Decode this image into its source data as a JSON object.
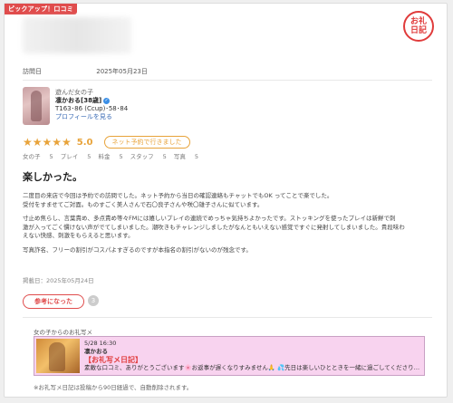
{
  "badge": "ピックアップ！口コミ",
  "stamp": {
    "line1": "お礼",
    "line2": "日記"
  },
  "visit": {
    "label": "訪問日",
    "date": "2025年05月23日"
  },
  "girl": {
    "label": "遊んだ女の子",
    "name": "凛かおる[38歳]",
    "specs": "T163･86 (Ccup)･58･84",
    "profile_link": "プロフィールを見る"
  },
  "rating": {
    "stars": "★★★★★",
    "score": "5.0",
    "net_booking": "ネット予約で行きました",
    "sub": [
      {
        "label": "女の子",
        "value": "5"
      },
      {
        "label": "プレイ",
        "value": "5"
      },
      {
        "label": "料金",
        "value": "5"
      },
      {
        "label": "スタッフ",
        "value": "5"
      },
      {
        "label": "写真",
        "value": "5"
      }
    ]
  },
  "review": {
    "title": "楽しかった。",
    "p1a": "二度目の来店で今回は予約での訪問でした。ネット予約から当日の確認連絡もチャットでもOK ってことで楽でした。",
    "p1b": "受付をすませてご対面。ものすごく美人さんで石〇良子さんや咲〇雄子さんに似ています。",
    "p2a": "寸止め焦らし、言葉責め、多点責め等々FMには嬉しいプレイの連続でめっちゃ気持ちよかったです。ストッキングを使ったプレイは新鮮で刺",
    "p2b": "激が入ってごく慣けない声がでてしまいました。潮吹きもチャレンジしましたがなんともいえない感覚ですぐに発射してしまいました。貴段味わ",
    "p2c": "えない快感、刺激をもらえると思います。",
    "p3": "写真詐名、フリーの割引がコスパよすぎるのですが本指名の割引がないのが残念です。",
    "posted": "掲載日：2025年05月24日",
    "helpful_label": "参考になった",
    "helpful_count": "3"
  },
  "thanks": {
    "header": "女の子からのお礼写メ",
    "datetime": "5/28 16:30",
    "name": "凛かおる",
    "title": "【お礼写メ日記】",
    "excerpt": "素敵な口コミ、ありがとうございます🌸お返事が遅くなりすみません🙏 💦先日は楽しいひとときを一緒に過ごしてくださり…"
  },
  "note": "※お礼写メ日記は投稿から90日経過で、自動削除されます。"
}
